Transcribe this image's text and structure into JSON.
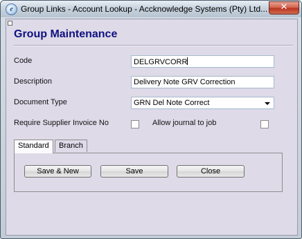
{
  "window": {
    "title": "Group Links - Account Lookup - Accknowledge Systems (Pty) Ltd...",
    "close_glyph": "✕",
    "app_icon_glyph": "e"
  },
  "form": {
    "title": "Group Maintenance",
    "code_label": "Code",
    "code_value": "DELGRVCORR",
    "description_label": "Description",
    "description_value": "Delivery Note GRV Correction",
    "document_type_label": "Document Type",
    "document_type_value": "GRN Del Note Correct",
    "require_supplier_invoice_label": "Require Supplier Invoice No",
    "require_supplier_invoice_checked": false,
    "allow_journal_label": "Allow journal to job",
    "allow_journal_checked": false
  },
  "tabs": [
    {
      "label": "Standard",
      "active": true
    },
    {
      "label": "Branch",
      "active": false
    }
  ],
  "buttons": {
    "save_new": "Save & New",
    "save": "Save",
    "close": "Close"
  }
}
